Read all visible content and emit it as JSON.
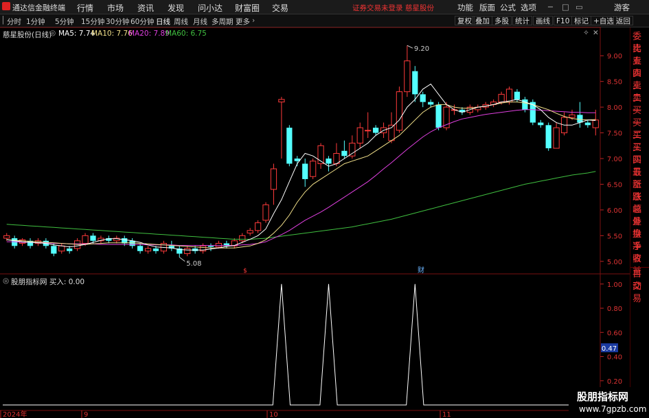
{
  "menubar": {
    "app_name": "通达信金融终端",
    "items": [
      "行情",
      "市场",
      "资讯",
      "发现",
      "问小达",
      "财富圈",
      "交易"
    ],
    "notice_login": "证券交易未登录",
    "notice_stock": "慈星股份",
    "right_items": [
      "功能",
      "版面",
      "公式",
      "选项"
    ],
    "guest": "游客"
  },
  "toolbar": {
    "periods": [
      "分时",
      "1分钟",
      "5分钟",
      "15分钟",
      "30分钟",
      "60分钟",
      "日线",
      "周线",
      "月线",
      "多周期",
      "更多"
    ],
    "active_period": "日线",
    "right_buttons": [
      "复权",
      "叠加",
      "多股",
      "统计",
      "画线",
      "F10",
      "标记",
      "+自选",
      "返回"
    ]
  },
  "main_legend": {
    "stock": "慈星股份(日线)",
    "ma5": "MA5: 7.74",
    "ma10": "MA10: 7.76",
    "ma20": "MA20: 7.89",
    "ma60": "MA60: 6.75",
    "colors": {
      "ma5": "#ffffff",
      "ma10": "#f2e08a",
      "ma20": "#e040e0",
      "ma60": "#40c040"
    }
  },
  "price_axis": [
    "9.00",
    "8.50",
    "8.00",
    "7.50",
    "7.00",
    "6.50",
    "6.00",
    "5.50",
    "5.00"
  ],
  "annotations": {
    "high": "9.20",
    "low": "5.08",
    "marker1": "$",
    "marker2": "财"
  },
  "indicator": {
    "legend": "股朋指标网  买入: 0.00",
    "axis": [
      "1.00",
      "0.80",
      "0.60",
      "0.40",
      "0.20"
    ],
    "current": "0.47"
  },
  "date_axis": {
    "labels": [
      "2024年",
      "9",
      "10",
      "11"
    ]
  },
  "sidebar": {
    "items": [
      "委比",
      "卖五",
      "卖四",
      "卖三",
      "卖二",
      "卖一",
      "买一",
      "买二",
      "买三",
      "买四",
      "买五",
      "最新",
      "涨跌",
      "涨幅",
      "总量",
      "外盘",
      "换手",
      "净资",
      "收益",
      "自动",
      "交易"
    ]
  },
  "watermark": {
    "line1": "股朋指标网",
    "line2": "www.7gpzb.com"
  },
  "chart_data": {
    "type": "candlestick",
    "ylim": [
      4.85,
      9.35
    ],
    "candles": [
      [
        5.45,
        5.5,
        5.4,
        5.55
      ],
      [
        5.45,
        5.3,
        5.25,
        5.5
      ],
      [
        5.35,
        5.42,
        5.3,
        5.45
      ],
      [
        5.4,
        5.3,
        5.25,
        5.45
      ],
      [
        5.35,
        5.4,
        5.3,
        5.45
      ],
      [
        5.4,
        5.3,
        5.25,
        5.45
      ],
      [
        5.3,
        5.15,
        5.1,
        5.35
      ],
      [
        5.2,
        5.3,
        5.15,
        5.35
      ],
      [
        5.25,
        5.2,
        5.15,
        5.3
      ],
      [
        5.25,
        5.4,
        5.2,
        5.45
      ],
      [
        5.35,
        5.5,
        5.3,
        5.55
      ],
      [
        5.5,
        5.4,
        5.35,
        5.55
      ],
      [
        5.4,
        5.45,
        5.35,
        5.5
      ],
      [
        5.45,
        5.4,
        5.35,
        5.5
      ],
      [
        5.4,
        5.45,
        5.35,
        5.5
      ],
      [
        5.45,
        5.35,
        5.3,
        5.5
      ],
      [
        5.4,
        5.3,
        5.25,
        5.45
      ],
      [
        5.3,
        5.2,
        5.15,
        5.35
      ],
      [
        5.2,
        5.25,
        5.15,
        5.3
      ],
      [
        5.25,
        5.2,
        5.15,
        5.3
      ],
      [
        5.2,
        5.35,
        5.15,
        5.4
      ],
      [
        5.3,
        5.25,
        5.2,
        5.4
      ],
      [
        5.25,
        5.15,
        5.08,
        5.3
      ],
      [
        5.15,
        5.25,
        5.1,
        5.3
      ],
      [
        5.25,
        5.2,
        5.15,
        5.3
      ],
      [
        5.2,
        5.3,
        5.15,
        5.35
      ],
      [
        5.3,
        5.28,
        5.2,
        5.35
      ],
      [
        5.28,
        5.35,
        5.25,
        5.4
      ],
      [
        5.35,
        5.3,
        5.25,
        5.4
      ],
      [
        5.3,
        5.4,
        5.25,
        5.45
      ],
      [
        5.4,
        5.5,
        5.35,
        5.55
      ],
      [
        5.55,
        5.6,
        5.5,
        5.65
      ],
      [
        5.6,
        5.75,
        5.55,
        5.8
      ],
      [
        5.8,
        6.1,
        5.75,
        6.15
      ],
      [
        6.4,
        6.8,
        6.1,
        6.9
      ],
      [
        8.1,
        8.15,
        7.0,
        8.2
      ],
      [
        7.6,
        6.9,
        6.85,
        7.65
      ],
      [
        7.0,
        6.95,
        6.85,
        7.05
      ],
      [
        6.9,
        6.6,
        6.45,
        7.0
      ],
      [
        6.65,
        6.95,
        6.6,
        7.0
      ],
      [
        6.9,
        7.25,
        6.8,
        7.3
      ],
      [
        7.0,
        6.9,
        6.75,
        7.05
      ],
      [
        6.9,
        7.1,
        6.85,
        7.3
      ],
      [
        7.15,
        7.05,
        7.0,
        7.35
      ],
      [
        7.05,
        7.3,
        7.0,
        7.45
      ],
      [
        7.3,
        7.6,
        7.2,
        7.7
      ],
      [
        7.55,
        7.55,
        7.4,
        7.9
      ],
      [
        7.6,
        7.5,
        7.45,
        7.65
      ],
      [
        7.5,
        7.6,
        7.4,
        7.7
      ],
      [
        7.35,
        7.65,
        7.3,
        7.9
      ],
      [
        7.55,
        8.3,
        7.5,
        8.4
      ],
      [
        8.3,
        8.9,
        8.2,
        9.2
      ],
      [
        8.7,
        8.25,
        8.1,
        8.8
      ],
      [
        8.25,
        8.1,
        8.0,
        8.3
      ],
      [
        8.1,
        8.05,
        8.0,
        8.15
      ],
      [
        8.05,
        7.6,
        7.55,
        8.1
      ],
      [
        7.6,
        8.0,
        7.55,
        8.1
      ],
      [
        7.95,
        7.95,
        7.85,
        8.05
      ],
      [
        7.95,
        7.9,
        7.85,
        8.0
      ],
      [
        7.9,
        8.0,
        7.85,
        8.05
      ],
      [
        7.95,
        8.0,
        7.9,
        8.05
      ],
      [
        8.0,
        8.05,
        7.95,
        8.1
      ],
      [
        8.05,
        8.1,
        8.0,
        8.15
      ],
      [
        8.1,
        8.25,
        8.05,
        8.3
      ],
      [
        8.1,
        8.35,
        8.05,
        8.4
      ],
      [
        8.3,
        8.15,
        8.1,
        8.35
      ],
      [
        8.15,
        7.95,
        7.9,
        8.2
      ],
      [
        8.1,
        7.7,
        7.65,
        8.15
      ],
      [
        7.7,
        7.65,
        7.6,
        7.75
      ],
      [
        7.65,
        7.2,
        7.15,
        7.7
      ],
      [
        7.2,
        7.6,
        7.2,
        7.7
      ],
      [
        7.5,
        7.8,
        7.45,
        7.9
      ],
      [
        7.8,
        7.85,
        7.75,
        7.95
      ],
      [
        7.85,
        7.7,
        7.6,
        8.1
      ],
      [
        7.7,
        7.65,
        7.6,
        7.75
      ],
      [
        7.6,
        7.75,
        7.45,
        7.95
      ]
    ],
    "ma5": [
      5.42,
      5.4,
      5.38,
      5.37,
      5.36,
      5.35,
      5.32,
      5.3,
      5.28,
      5.3,
      5.33,
      5.37,
      5.41,
      5.44,
      5.44,
      5.42,
      5.4,
      5.37,
      5.32,
      5.28,
      5.27,
      5.26,
      5.23,
      5.22,
      5.22,
      5.22,
      5.24,
      5.26,
      5.29,
      5.31,
      5.37,
      5.43,
      5.5,
      5.63,
      5.93,
      6.2,
      6.55,
      6.9,
      7.1,
      7.05,
      6.95,
      6.85,
      6.9,
      7.0,
      7.1,
      7.2,
      7.3,
      7.45,
      7.55,
      7.6,
      7.75,
      8.0,
      8.15,
      8.35,
      8.45,
      8.25,
      8.05,
      7.95,
      7.9,
      7.95,
      8.0,
      8.02,
      8.05,
      8.1,
      8.12,
      8.15,
      8.1,
      8.05,
      7.95,
      7.8,
      7.7,
      7.65,
      7.65,
      7.7,
      7.75,
      7.74
    ],
    "ma10": [
      5.42,
      5.41,
      5.4,
      5.39,
      5.38,
      5.37,
      5.36,
      5.35,
      5.34,
      5.33,
      5.33,
      5.34,
      5.35,
      5.36,
      5.36,
      5.36,
      5.36,
      5.35,
      5.34,
      5.33,
      5.32,
      5.31,
      5.3,
      5.29,
      5.28,
      5.27,
      5.26,
      5.26,
      5.26,
      5.26,
      5.28,
      5.3,
      5.35,
      5.42,
      5.55,
      5.7,
      5.9,
      6.15,
      6.35,
      6.5,
      6.6,
      6.7,
      6.8,
      6.9,
      6.95,
      7.0,
      7.05,
      7.15,
      7.25,
      7.35,
      7.45,
      7.6,
      7.75,
      7.9,
      8.0,
      8.05,
      8.05,
      8.0,
      7.98,
      7.98,
      8.0,
      8.02,
      8.05,
      8.08,
      8.1,
      8.1,
      8.08,
      8.05,
      8.0,
      7.95,
      7.88,
      7.82,
      7.78,
      7.76,
      7.75,
      7.76
    ],
    "ma20": [
      5.38,
      5.38,
      5.37,
      5.37,
      5.36,
      5.36,
      5.35,
      5.35,
      5.34,
      5.34,
      5.34,
      5.34,
      5.33,
      5.33,
      5.33,
      5.33,
      5.33,
      5.33,
      5.32,
      5.32,
      5.32,
      5.32,
      5.31,
      5.31,
      5.31,
      5.31,
      5.31,
      5.31,
      5.31,
      5.31,
      5.32,
      5.33,
      5.35,
      5.38,
      5.45,
      5.52,
      5.6,
      5.7,
      5.8,
      5.88,
      5.96,
      6.05,
      6.15,
      6.25,
      6.35,
      6.45,
      6.55,
      6.67,
      6.8,
      6.92,
      7.05,
      7.18,
      7.3,
      7.42,
      7.52,
      7.6,
      7.66,
      7.72,
      7.77,
      7.8,
      7.83,
      7.86,
      7.88,
      7.9,
      7.92,
      7.94,
      7.95,
      7.95,
      7.94,
      7.93,
      7.92,
      7.91,
      7.9,
      7.9,
      7.89,
      7.89
    ],
    "ma60": [
      5.72,
      5.71,
      5.7,
      5.69,
      5.68,
      5.67,
      5.66,
      5.65,
      5.64,
      5.63,
      5.62,
      5.61,
      5.6,
      5.59,
      5.58,
      5.57,
      5.56,
      5.55,
      5.54,
      5.53,
      5.52,
      5.51,
      5.5,
      5.49,
      5.48,
      5.47,
      5.46,
      5.45,
      5.44,
      5.43,
      5.43,
      5.43,
      5.44,
      5.45,
      5.47,
      5.49,
      5.51,
      5.53,
      5.55,
      5.57,
      5.59,
      5.61,
      5.63,
      5.65,
      5.67,
      5.7,
      5.73,
      5.76,
      5.79,
      5.82,
      5.86,
      5.9,
      5.94,
      5.98,
      6.02,
      6.06,
      6.1,
      6.14,
      6.18,
      6.22,
      6.26,
      6.3,
      6.34,
      6.38,
      6.42,
      6.46,
      6.5,
      6.53,
      6.56,
      6.59,
      6.62,
      6.65,
      6.68,
      6.7,
      6.72,
      6.75
    ],
    "signal_spikes": [
      35,
      41,
      52
    ],
    "indicator_ylim": [
      0,
      1.05
    ]
  }
}
